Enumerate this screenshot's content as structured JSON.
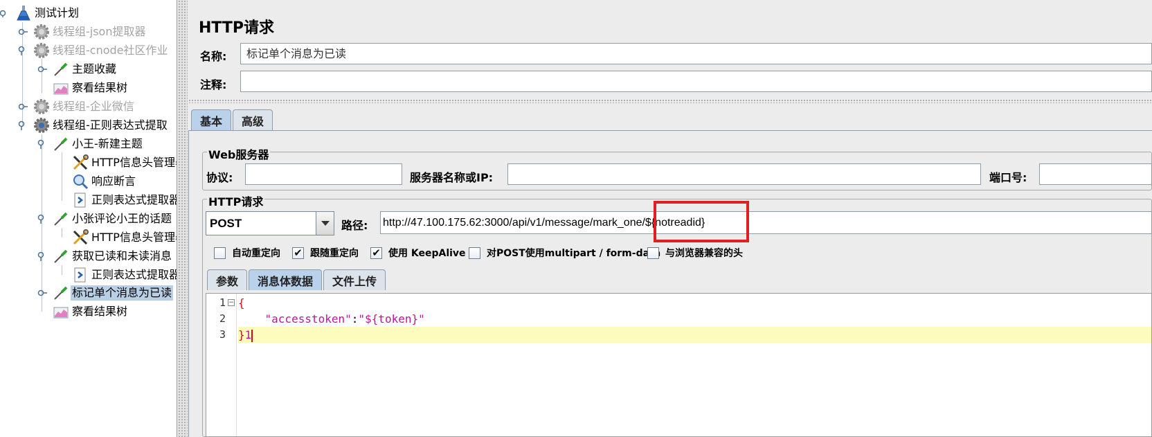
{
  "tree": {
    "items": [
      {
        "label": "测试计划",
        "icon": "flask-icon",
        "level": 0,
        "disabled": false,
        "selected": false,
        "toggle": "open"
      },
      {
        "label": "线程组-json提取器",
        "icon": "gear-icon",
        "level": 1,
        "disabled": true,
        "selected": false,
        "toggle": "closed"
      },
      {
        "label": "线程组-cnode社区作业",
        "icon": "gear-icon",
        "level": 1,
        "disabled": true,
        "selected": false,
        "toggle": "open"
      },
      {
        "label": "主题收藏",
        "icon": "pipette-icon",
        "level": 2,
        "disabled": false,
        "selected": false,
        "toggle": "closed"
      },
      {
        "label": "察看结果树",
        "icon": "chart-icon",
        "level": 2,
        "disabled": false,
        "selected": false,
        "toggle": "none"
      },
      {
        "label": "线程组-企业微信",
        "icon": "gear-icon",
        "level": 1,
        "disabled": true,
        "selected": false,
        "toggle": "closed"
      },
      {
        "label": "线程组-正则表达式提取",
        "icon": "gear-icon",
        "level": 1,
        "disabled": false,
        "selected": false,
        "toggle": "open"
      },
      {
        "label": "小王-新建主题",
        "icon": "pipette-icon",
        "level": 2,
        "disabled": false,
        "selected": false,
        "toggle": "open"
      },
      {
        "label": "HTTP信息头管理器",
        "icon": "tools-icon",
        "level": 3,
        "disabled": false,
        "selected": false,
        "toggle": "none"
      },
      {
        "label": "响应断言",
        "icon": "magnifier-icon",
        "level": 3,
        "disabled": false,
        "selected": false,
        "toggle": "none"
      },
      {
        "label": "正则表达式提取器",
        "icon": "extractor-icon",
        "level": 3,
        "disabled": false,
        "selected": false,
        "toggle": "none"
      },
      {
        "label": "小张评论小王的话题",
        "icon": "pipette-icon",
        "level": 2,
        "disabled": false,
        "selected": false,
        "toggle": "open"
      },
      {
        "label": "HTTP信息头管理器",
        "icon": "tools-icon",
        "level": 3,
        "disabled": false,
        "selected": false,
        "toggle": "none"
      },
      {
        "label": "获取已读和未读消息",
        "icon": "pipette-icon",
        "level": 2,
        "disabled": false,
        "selected": false,
        "toggle": "open"
      },
      {
        "label": "正则表达式提取器",
        "icon": "extractor-icon",
        "level": 3,
        "disabled": false,
        "selected": false,
        "toggle": "none"
      },
      {
        "label": "标记单个消息为已读",
        "icon": "pipette-icon",
        "level": 2,
        "disabled": false,
        "selected": true,
        "toggle": "closed"
      },
      {
        "label": "察看结果树",
        "icon": "chart-icon",
        "level": 2,
        "disabled": false,
        "selected": false,
        "toggle": "none"
      }
    ]
  },
  "panel": {
    "title": "HTTP请求",
    "name_label": "名称:",
    "name_value": "标记单个消息为已读",
    "comment_label": "注释:",
    "comment_value": "",
    "tabs": [
      {
        "label": "基本",
        "active": true
      },
      {
        "label": "高级",
        "active": false
      }
    ]
  },
  "web_server": {
    "legend": "Web服务器",
    "protocol_label": "协议:",
    "protocol_value": "",
    "server_label": "服务器名称或IP:",
    "server_value": "",
    "port_label": "端口号:",
    "port_value": ""
  },
  "http_request": {
    "legend": "HTTP请求",
    "method": "POST",
    "path_label": "路径:",
    "path_value": "http://47.100.175.62:3000/api/v1/message/mark_one/${notreadid}"
  },
  "options": [
    {
      "label": "自动重定向",
      "checked": false
    },
    {
      "label": "跟随重定向",
      "checked": true
    },
    {
      "label": "使用 KeepAlive",
      "checked": true
    },
    {
      "label": "对POST使用multipart / form-data",
      "checked": false
    },
    {
      "label": "与浏览器兼容的头",
      "checked": false
    }
  ],
  "sub_tabs": [
    {
      "label": "参数",
      "active": false
    },
    {
      "label": "消息体数据",
      "active": true
    },
    {
      "label": "文件上传",
      "active": false
    }
  ],
  "body_editor": {
    "line_numbers": [
      "1",
      "2",
      "3"
    ],
    "line1": "{",
    "line2_key": "\"accesstoken\"",
    "line2_colon": ":",
    "line2_value": "\"${token}\"",
    "line3_brace": "}",
    "line3_tail": "1"
  },
  "colors": {
    "highlight_box": "#e02020",
    "selected_row": "#b8cfe5",
    "current_line": "#fdfcbc"
  }
}
